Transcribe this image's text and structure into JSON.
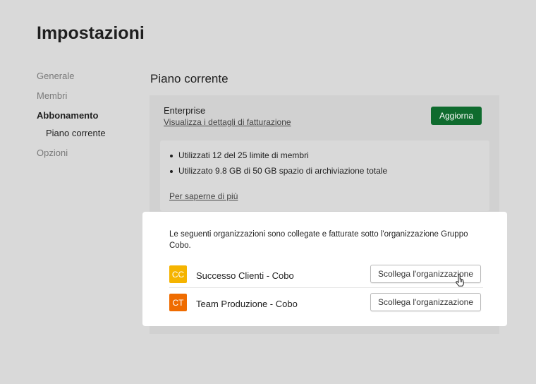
{
  "page": {
    "title": "Impostazioni"
  },
  "sidebar": {
    "items": [
      {
        "label": "Generale"
      },
      {
        "label": "Membri"
      },
      {
        "label": "Abbonamento"
      },
      {
        "label": "Piano corrente"
      },
      {
        "label": "Opzioni"
      }
    ]
  },
  "plan": {
    "section_title": "Piano corrente",
    "name": "Enterprise",
    "billing_link": "Visualizza i dettagli di fatturazione",
    "upgrade_label": "Aggiorna",
    "usage": [
      "Utilizzati 12 del 25 limite di membri",
      "Utilizzato 9.8 GB di 50 GB spazio di archiviazione totale"
    ],
    "learn_more": "Per saperne di più"
  },
  "linked": {
    "description": "Le seguenti organizzazioni sono collegate e fatturate sotto l'organizzazione Gruppo Cobo.",
    "orgs": [
      {
        "initials": "CC",
        "name": "Successo Clienti - Cobo",
        "action": "Scollega l'organizzazione",
        "color": "#f5b400"
      },
      {
        "initials": "CT",
        "name": "Team Produzione - Cobo",
        "action": "Scollega l'organizzazione",
        "color": "#ef6c00"
      }
    ]
  },
  "colors": {
    "accent": "#0f6b2e",
    "background": "#d9d9d9"
  },
  "icons": {
    "cursor": "hand-pointer-icon"
  }
}
